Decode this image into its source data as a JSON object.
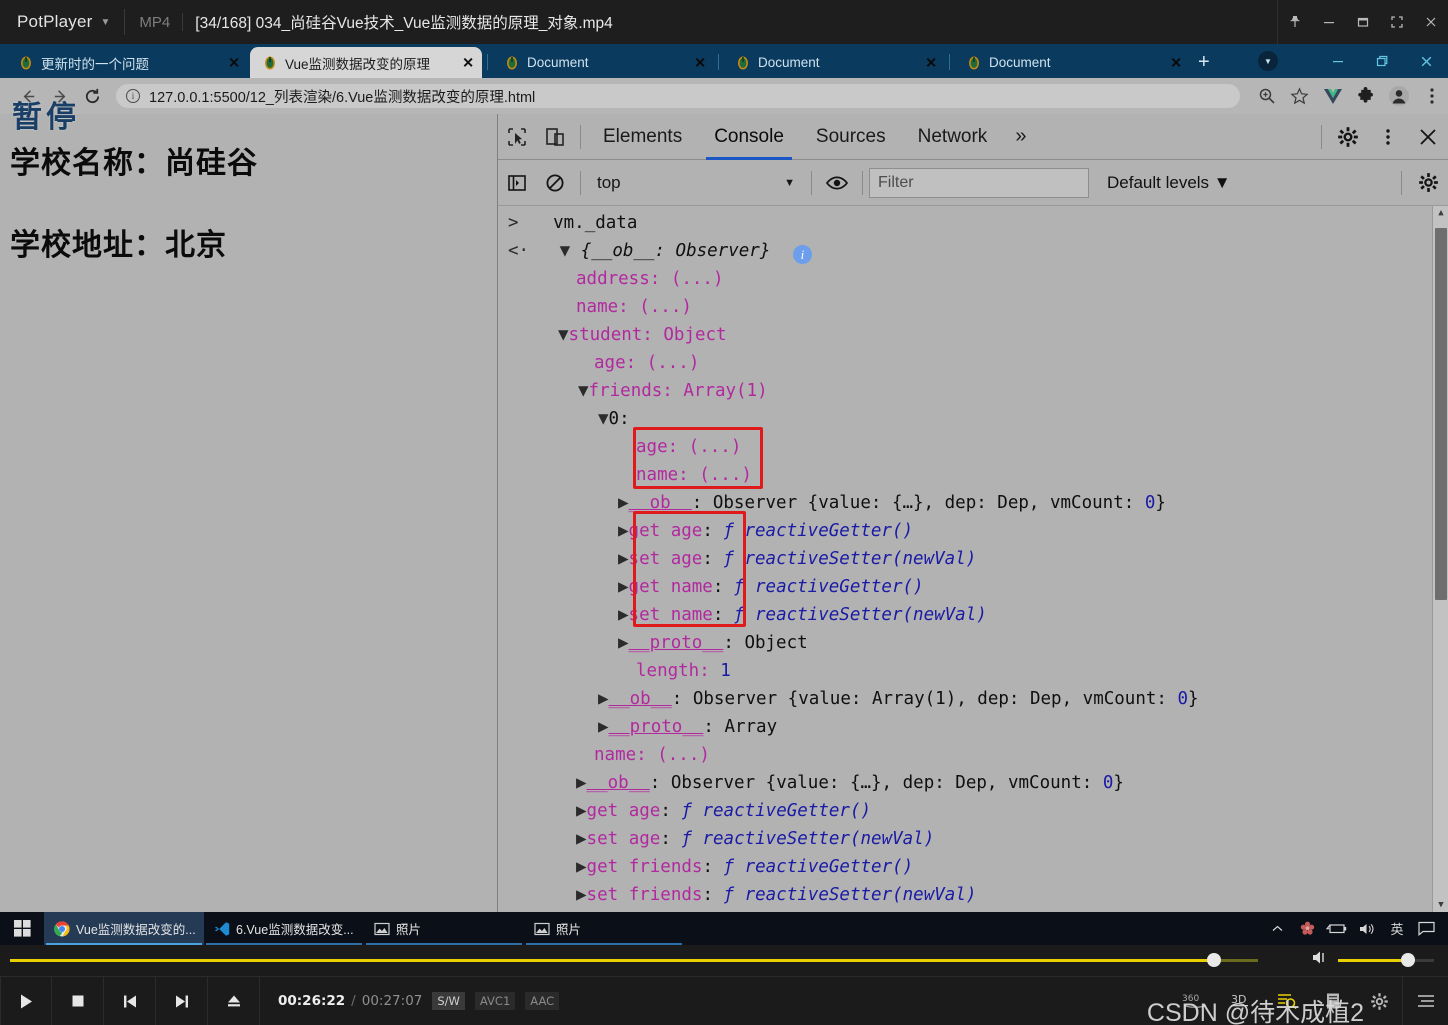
{
  "potplayer": {
    "app_name": "PotPlayer",
    "format_label": "MP4",
    "media_title": "[34/168] 034_尚硅谷Vue技术_Vue监测数据的原理_对象.mp4",
    "window_buttons": [
      {
        "name": "pin",
        "glyph": "pin-icon"
      },
      {
        "name": "minimize",
        "glyph": "minimize-icon"
      },
      {
        "name": "restore",
        "glyph": "restore-icon"
      },
      {
        "name": "fullscreen",
        "glyph": "fullscreen-icon"
      },
      {
        "name": "close",
        "glyph": "close-icon"
      }
    ],
    "paused_overlay": "暂停",
    "controls": {
      "play_label": "play-icon",
      "stop_label": "stop-icon",
      "prev_label": "previous-icon",
      "next_label": "next-icon",
      "eject_label": "eject-icon",
      "current_time": "00:26:22",
      "separator": "/",
      "total_time": "00:27:07",
      "chips": [
        "S/W",
        "AVC1",
        "AAC"
      ],
      "right_buttons": [
        "360",
        "3D",
        "playlist-search",
        "playlist",
        "settings",
        "menu"
      ],
      "watermark": "CSDN @待木成植2",
      "seek_percent": 96.5,
      "volume_percent": 73,
      "accent_color": "#e8d000"
    }
  },
  "browser": {
    "tabs": [
      {
        "title": "更新时的一个问题",
        "active": false,
        "favicon": "vue-icon",
        "close": "✕"
      },
      {
        "title": "Vue监测数据改变的原理",
        "active": true,
        "favicon": "vue-icon",
        "close": "✕"
      },
      {
        "title": "Document",
        "active": false,
        "favicon": "vue-icon",
        "close": "✕"
      },
      {
        "title": "Document",
        "active": false,
        "favicon": "vue-icon",
        "close": "✕"
      },
      {
        "title": "Document",
        "active": false,
        "favicon": "vue-icon",
        "close": "✕"
      }
    ],
    "new_tab_label": "+",
    "window_buttons": [
      "minimize-icon",
      "restore-icon",
      "close-icon"
    ],
    "nav": {
      "back": "back-icon",
      "forward": "forward-icon",
      "reload": "reload-icon"
    },
    "address": {
      "site_info": "info-icon",
      "url": "127.0.0.1:5500/12_列表渲染/6.Vue监测数据改变的原理.html"
    },
    "omnibox_buttons": [
      "zoom-icon",
      "bookmark-star-icon",
      "vue-devtools-icon",
      "extensions-puzzle-icon",
      "profile-avatar-icon",
      "chrome-menu-icon"
    ]
  },
  "page": {
    "line1": "学校名称：尚硅谷",
    "line2": "学校地址：北京"
  },
  "devtools": {
    "left_icons": [
      "inspect-element-icon",
      "device-toolbar-icon"
    ],
    "tabs": [
      {
        "label": "Elements",
        "selected": false
      },
      {
        "label": "Console",
        "selected": true
      },
      {
        "label": "Sources",
        "selected": false
      },
      {
        "label": "Network",
        "selected": false
      }
    ],
    "more_tabs": "»",
    "right_icons": [
      "settings-gear-icon",
      "more-options-icon",
      "close-devtools-icon"
    ],
    "filterbar": {
      "sidebar_toggle": "console-sidebar-icon",
      "clear": "clear-console-icon",
      "context": "top",
      "context_caret": "▼",
      "eye": "live-expression-icon",
      "filter_placeholder": "Filter",
      "filter_value": "",
      "levels": "Default levels",
      "levels_caret": "▼",
      "settings": "console-settings-icon"
    },
    "console_lines": [
      {
        "indent": 0,
        "prompt": ">",
        "text": "vm._data"
      },
      {
        "indent": 0,
        "prompt": "<·",
        "text": "{__ob__: Observer}",
        "info": "i"
      },
      {
        "indent": 1,
        "text": "address: (...)"
      },
      {
        "indent": 1,
        "text": "name: (...)"
      },
      {
        "indent": 1,
        "text": "student: Object"
      },
      {
        "indent": 2,
        "text": "age: (...)"
      },
      {
        "indent": 2,
        "text": "friends: Array(1)"
      },
      {
        "indent": 3,
        "text": "0:"
      },
      {
        "indent": 4,
        "text": "age: (...)"
      },
      {
        "indent": 4,
        "text": "name: (...)"
      },
      {
        "indent": 4,
        "text": "__ob__: Observer {value: {…}, dep: Dep, vmCount: 0}"
      },
      {
        "indent": 4,
        "text": "get age: ƒ reactiveGetter()"
      },
      {
        "indent": 4,
        "text": "set age: ƒ reactiveSetter(newVal)"
      },
      {
        "indent": 4,
        "text": "get name: ƒ reactiveGetter()"
      },
      {
        "indent": 4,
        "text": "set name: ƒ reactiveSetter(newVal)"
      },
      {
        "indent": 4,
        "text": "__proto__: Object"
      },
      {
        "indent": 3,
        "text": "length: 1"
      },
      {
        "indent": 3,
        "text": "__ob__: Observer {value: Array(1), dep: Dep, vmCount: 0}"
      },
      {
        "indent": 3,
        "text": "__proto__: Array"
      },
      {
        "indent": 2,
        "text": "name: (...)"
      },
      {
        "indent": 2,
        "text": "__ob__: Observer {value: {…}, dep: Dep, vmCount: 0}"
      },
      {
        "indent": 2,
        "text": "get age: ƒ reactiveGetter()"
      },
      {
        "indent": 2,
        "text": "set age: ƒ reactiveSetter(newVal)"
      },
      {
        "indent": 2,
        "text": "get friends: ƒ reactiveGetter()"
      },
      {
        "indent": 2,
        "text": "set friends: ƒ reactiveSetter(newVal)"
      }
    ],
    "annotations": {
      "box1_note": "red highlight around age/name (...) of friends[0]",
      "box2_note": "red highlight around get/set age & name accessors",
      "highlight_color": "#e01a1a"
    },
    "scrollbar": {
      "thumb_top_pct": 3,
      "thumb_height_pct": 53
    }
  },
  "taskbar": {
    "start": "windows-start-icon",
    "items": [
      {
        "label": "Vue监测数据改变的...",
        "icon": "chrome-icon",
        "active": true
      },
      {
        "label": "6.Vue监测数据改变...",
        "icon": "vscode-icon",
        "active": false
      },
      {
        "label": "照片",
        "icon": "photos-icon",
        "active": false
      },
      {
        "label": "照片",
        "icon": "photos-icon",
        "active": false
      }
    ],
    "tray": [
      "show-hidden-icon",
      "flower-icon",
      "battery-icon",
      "volume-icon",
      "英",
      "notifications-icon"
    ]
  }
}
